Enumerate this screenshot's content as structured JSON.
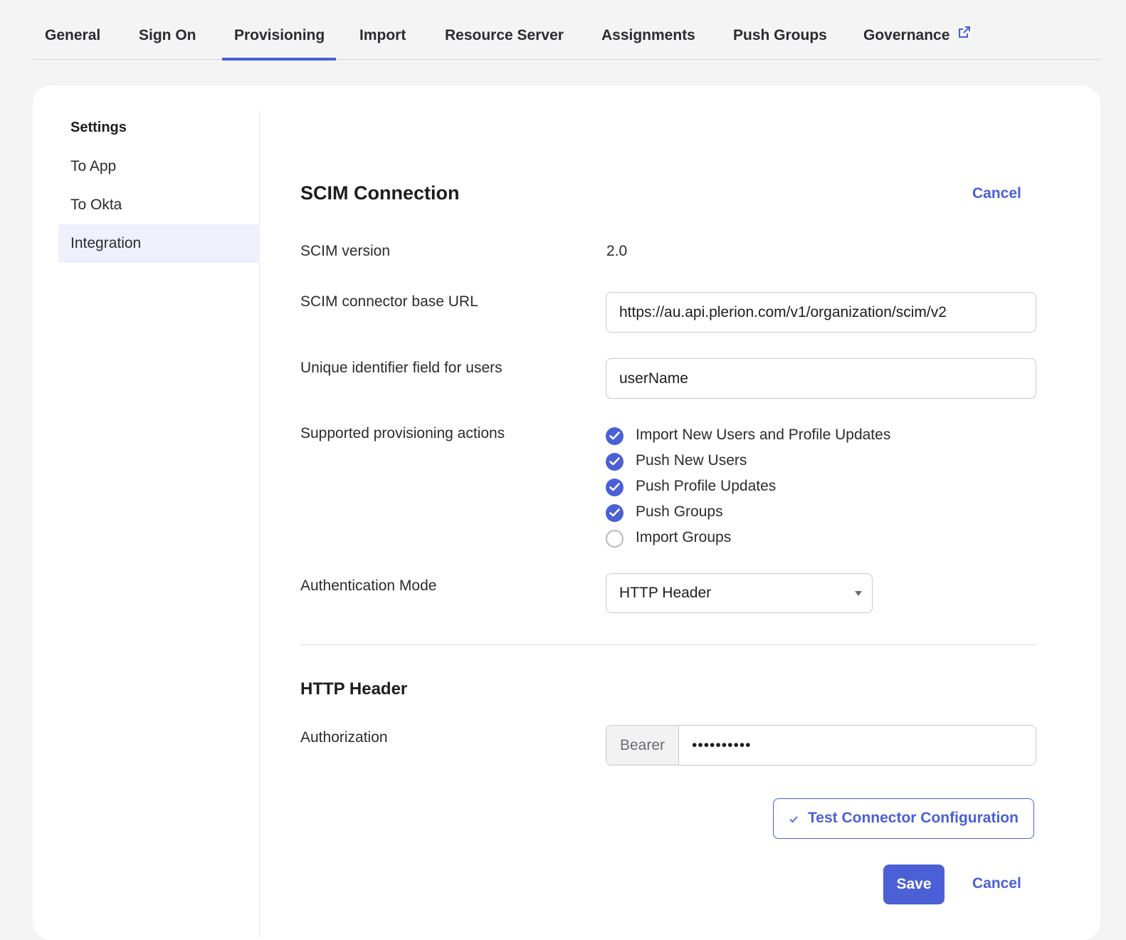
{
  "tabs": [
    {
      "label": "General"
    },
    {
      "label": "Sign On"
    },
    {
      "label": "Provisioning",
      "active": true
    },
    {
      "label": "Import"
    },
    {
      "label": "Resource Server"
    },
    {
      "label": "Assignments"
    },
    {
      "label": "Push Groups"
    },
    {
      "label": "Governance",
      "icon": "external-link-icon"
    }
  ],
  "sidebar": {
    "title": "Settings",
    "items": [
      {
        "label": "To App"
      },
      {
        "label": "To Okta"
      },
      {
        "label": "Integration",
        "active": true
      }
    ]
  },
  "scim": {
    "title": "SCIM Connection",
    "cancel_label": "Cancel",
    "version_label": "SCIM version",
    "version_value": "2.0",
    "base_url_label": "SCIM connector base URL",
    "base_url_value": "https://au.api.plerion.com/v1/organization/scim/v2",
    "unique_id_label": "Unique identifier field for users",
    "unique_id_value": "userName",
    "actions_label": "Supported provisioning actions",
    "actions": [
      {
        "label": "Import New Users and Profile Updates",
        "checked": true
      },
      {
        "label": "Push New Users",
        "checked": true
      },
      {
        "label": "Push Profile Updates",
        "checked": true
      },
      {
        "label": "Push Groups",
        "checked": true
      },
      {
        "label": "Import Groups",
        "checked": false
      }
    ],
    "auth_mode_label": "Authentication Mode",
    "auth_mode_value": "HTTP Header"
  },
  "http_header": {
    "title": "HTTP Header",
    "authorization_label": "Authorization",
    "prefix": "Bearer",
    "secret_mask": "••••••••••"
  },
  "buttons": {
    "test_label": "Test Connector Configuration",
    "save_label": "Save",
    "cancel_label": "Cancel"
  },
  "colors": {
    "accent": "#4b5fd6",
    "background": "#f4f4f4",
    "active_nav_bg": "#eef0fb"
  }
}
